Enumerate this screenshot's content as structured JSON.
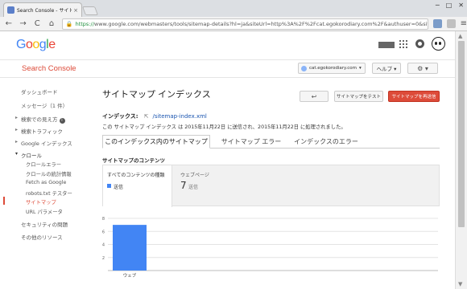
{
  "browser": {
    "tab_title": "Search Console - サイトマ",
    "tab_close": "×",
    "window_controls": [
      "─",
      "□",
      "✕"
    ],
    "url_secure": "https://",
    "url_rest": "www.google.com/webmasters/tools/sitemap-details?hl=ja&siteUrl=http%3A%2F%2Fcat.egokorodiary.com%2F&authuser=0&sitema",
    "back": "←",
    "forward": "→",
    "reload": "C",
    "home": "⌂",
    "star": "☆",
    "menu": "≡"
  },
  "google_bar": {
    "logo": [
      "G",
      "o",
      "o",
      "g",
      "l",
      "e"
    ]
  },
  "header": {
    "app_title": "Search Console",
    "site": "cat.egokorodiary.com",
    "site_caret": "▾",
    "help": "ヘルプ ▾",
    "settings": "⚙ ▾"
  },
  "sidebar": {
    "items": [
      {
        "label": "ダッシュボード"
      },
      {
        "label": "メッセージ（1 件）"
      },
      {
        "label": "検索での見え方"
      },
      {
        "label": "検索トラフィック"
      },
      {
        "label": "Google インデックス"
      },
      {
        "label": "クロール"
      },
      {
        "label": "セキュリティの問題"
      },
      {
        "label": "その他のリソース"
      }
    ],
    "crawl_subitems": [
      {
        "label": "クロールエラー"
      },
      {
        "label": "クロールの統計情報"
      },
      {
        "label": "Fetch as Google"
      },
      {
        "label": "robots.txt テスター"
      },
      {
        "label": "サイトマップ"
      },
      {
        "label": "URL パラメータ"
      }
    ],
    "info_icon": "i"
  },
  "main": {
    "title": "サイトマップ インデックス",
    "back_button": "↩",
    "test_button": "サイトマップをテスト",
    "resubmit_button": "サイトマップを再送信",
    "index_label": "インデックス:",
    "index_ext_icon": "⇱",
    "index_link": "/sitemap-index.xml",
    "submitted_text": "この サイトマップ インデックス は 2015年11月22日 に送信され、2015年11月22日 に処理されました。",
    "tabs": [
      {
        "label": "このインデックス内のサイトマップ"
      },
      {
        "label": "サイトマップ エラー"
      },
      {
        "label": "インデックスのエラー"
      }
    ],
    "content_title": "サイトマップのコンテンツ",
    "stats": {
      "all_heading": "すべてのコンテンツの種類",
      "all_legend": "送信",
      "web_heading": "ウェブページ",
      "web_value": "7",
      "web_sub": "送信"
    }
  },
  "chart_data": {
    "type": "bar",
    "categories": [
      "ウェブ"
    ],
    "series": [
      {
        "name": "送信",
        "values": [
          7
        ],
        "color": "#4285f4"
      }
    ],
    "yticks": [
      2,
      4,
      6,
      8
    ],
    "ylim": [
      0,
      8
    ],
    "grid": true,
    "title": "",
    "xlabel": "",
    "ylabel": ""
  },
  "scrollbar": {
    "up": "▲",
    "down": "▼"
  }
}
